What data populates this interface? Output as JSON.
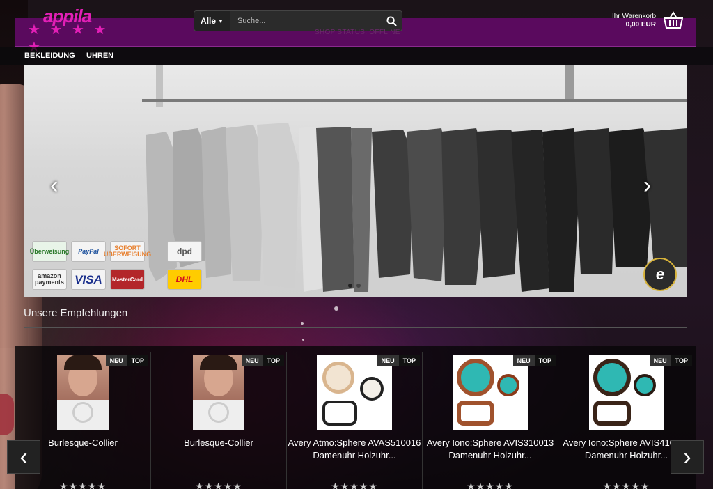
{
  "brand": {
    "name": "appila",
    "stars": "★ ★ ★ ★ ★"
  },
  "search": {
    "category": "Alle",
    "placeholder": "Suche..."
  },
  "shop_status": "SHOP STATUS: OFFLINE",
  "cart": {
    "label": "Ihr Warenkorb",
    "amount": "0,00 EUR"
  },
  "nav": {
    "items": [
      {
        "label": "BEKLEIDUNG"
      },
      {
        "label": "UHREN"
      }
    ]
  },
  "banner": {
    "prev": "‹",
    "next": "›",
    "payments_left": [
      [
        "Überweisung",
        "PayPal",
        "SOFORT ÜBERWEISUNG"
      ],
      [
        "amazon payments",
        "VISA",
        "MasterCard"
      ]
    ],
    "shipping": [
      "dpd",
      "DHL"
    ],
    "trust_badge": "e"
  },
  "recommendations": {
    "title": "Unsere Empfehlungen",
    "badge_new": "NEU",
    "badge_top": "TOP",
    "rating": "★★★★★",
    "products": [
      {
        "name": "Burlesque-Collier"
      },
      {
        "name": "Burlesque-Collier"
      },
      {
        "name": "Avery Atmo:Sphere AVAS510016 Damenuhr Holzuhr..."
      },
      {
        "name": "Avery Iono:Sphere AVIS310013 Damenuhr Holzuhr..."
      },
      {
        "name": "Avery Iono:Sphere AVIS410015 Damenuhr Holzuhr..."
      }
    ],
    "prev": "‹",
    "next": "›"
  },
  "colors": {
    "header": "#5a0a5e",
    "brand": "#e21fb6"
  }
}
